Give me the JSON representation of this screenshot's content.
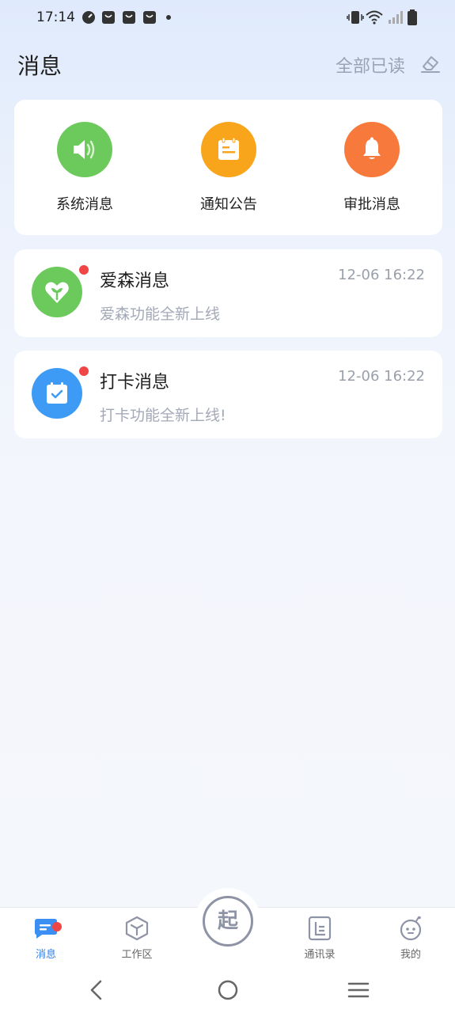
{
  "status_bar": {
    "time": "17:14"
  },
  "header": {
    "title": "消息",
    "mark_all_read": "全部已读"
  },
  "categories": [
    {
      "label": "系统消息",
      "icon": "speaker-icon",
      "color": "#6cc95c"
    },
    {
      "label": "通知公告",
      "icon": "notepad-icon",
      "color": "#f8a51c"
    },
    {
      "label": "审批消息",
      "icon": "bell-icon",
      "color": "#f77a3c"
    }
  ],
  "messages": [
    {
      "title": "爱森消息",
      "time": "12-06 16:22",
      "preview": "爱森功能全新上线",
      "icon": "heart-sprout-icon",
      "color": "#6cc95c",
      "unread": true
    },
    {
      "title": "打卡消息",
      "time": "12-06 16:22",
      "preview": "打卡功能全新上线!",
      "icon": "calendar-check-icon",
      "color": "#3e9bf5",
      "unread": true
    }
  ],
  "bottom_nav": {
    "items": [
      {
        "label": "消息",
        "icon": "message-icon",
        "active": true,
        "badge": true
      },
      {
        "label": "工作区",
        "icon": "cube-icon",
        "active": false
      },
      {
        "label": "通讯录",
        "icon": "contacts-icon",
        "active": false
      },
      {
        "label": "我的",
        "icon": "profile-face-icon",
        "active": false
      }
    ],
    "center_button": "起"
  },
  "colors": {
    "accent": "#2d7ff0",
    "badge": "#f04545",
    "muted_text": "#9aa3b4"
  }
}
